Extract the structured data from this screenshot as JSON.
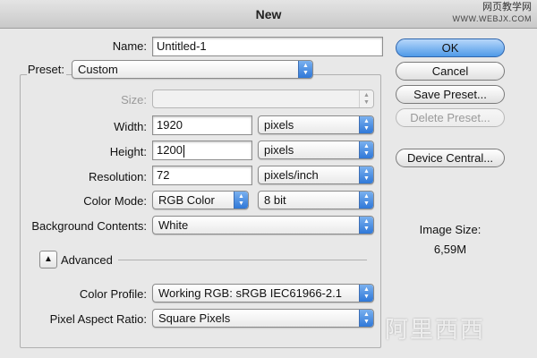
{
  "window": {
    "title": "New"
  },
  "watermark": {
    "site_name": "网页教学网",
    "site_url": "WWW.WEBJX.COM",
    "corner_text": "阿里西西"
  },
  "form": {
    "name_label": "Name:",
    "name_value": "Untitled-1",
    "preset_label": "Preset:",
    "preset_value": "Custom",
    "size_label": "Size:",
    "size_value": "",
    "width_label": "Width:",
    "width_value": "1920",
    "width_unit": "pixels",
    "height_label": "Height:",
    "height_value": "1200",
    "height_unit": "pixels",
    "resolution_label": "Resolution:",
    "resolution_value": "72",
    "resolution_unit": "pixels/inch",
    "color_mode_label": "Color Mode:",
    "color_mode_value": "RGB Color",
    "bit_depth_value": "8 bit",
    "background_label": "Background Contents:",
    "background_value": "White",
    "advanced_label": "Advanced",
    "color_profile_label": "Color Profile:",
    "color_profile_value": "Working RGB:  sRGB IEC61966-2.1",
    "pixel_aspect_label": "Pixel Aspect Ratio:",
    "pixel_aspect_value": "Square Pixels"
  },
  "buttons": {
    "ok": "OK",
    "cancel": "Cancel",
    "save_preset": "Save Preset...",
    "delete_preset": "Delete Preset...",
    "device_central": "Device Central..."
  },
  "image_size": {
    "label": "Image Size:",
    "value": "6,59M"
  },
  "colors": {
    "accent": "#4f9ae8",
    "dialog_bg": "#e8e8e8"
  }
}
